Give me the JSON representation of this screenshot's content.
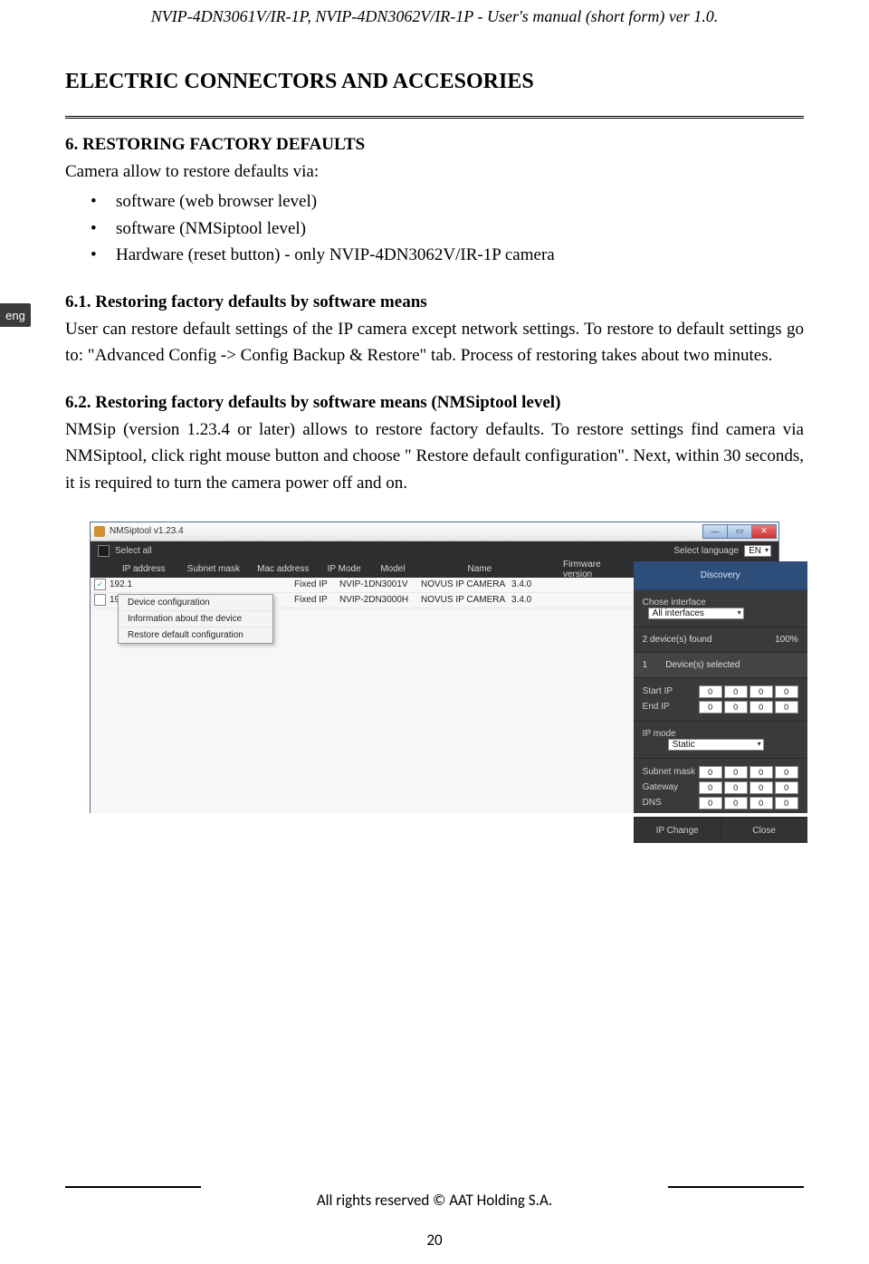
{
  "runningHead": "NVIP-4DN3061V/IR-1P, NVIP-4DN3062V/IR-1P - User's manual (short form) ver 1.0.",
  "sectionTitle": "ELECTRIC CONNECTORS AND ACCESORIES",
  "langTab": "eng",
  "h6_0": "6. RESTORING FACTORY DEFAULTS",
  "p0": "Camera allow to restore defaults via:",
  "bullets": {
    "b0": "software (web browser level)",
    "b1": "software (NMSiptool level)",
    "b2": "Hardware (reset button) - only NVIP-4DN3062V/IR-1P camera"
  },
  "h6_1": "6.1. Restoring factory defaults by software means",
  "p1": "User can restore default settings of the IP camera except network settings. To restore to default settings go to: \"Advanced Config -> Config Backup & Restore\" tab. Process of restoring takes about two minutes.",
  "h6_2": "6.2. Restoring factory defaults by software means (NMSiptool level)",
  "p2": "NMSip (version 1.23.4 or later) allows to restore factory defaults. To restore settings find camera via NMSiptool, click right mouse button and choose \" Restore default configuration\". Next, within 30 seconds, it is required to turn the camera power off and on.",
  "shot": {
    "title": "NMSiptool v1.23.4",
    "selectAll": "Select all",
    "selLangLbl": "Select language",
    "selLangVal": "EN",
    "cols": {
      "c0": "IP address",
      "c1": "Subnet mask",
      "c2": "Mac address",
      "c3": "IP Mode",
      "c4": "Model",
      "c5": "Name",
      "c6": "Firmware version"
    },
    "rows": {
      "r0": {
        "ip": "192.1",
        "mode": "Fixed IP",
        "model": "NVIP-1DN3001V",
        "name": "NOVUS IP CAMERA",
        "fw": "3.4.0"
      },
      "r1": {
        "ip": "192.1",
        "mode": "Fixed IP",
        "model": "NVIP-2DN3000H",
        "name": "NOVUS IP CAMERA",
        "fw": "3.4.0"
      }
    },
    "ctx": {
      "m0": "Device configuration",
      "m1": "Information about the device",
      "m2": "Restore default configuration"
    },
    "discovery": "Discovery",
    "choseIf": "Chose interface",
    "choseIfVal": "All interfaces",
    "found": "2 device(s) found",
    "foundPct": "100%",
    "selCount": "1",
    "selLbl": "Device(s) selected",
    "startIp": "Start IP",
    "endIp": "End IP",
    "ipMode": "IP mode",
    "ipModeVal": "Static",
    "subnet": "Subnet mask",
    "gateway": "Gateway",
    "dns": "DNS",
    "ipChange": "IP Change",
    "close": "Close",
    "oct": {
      "a": "0",
      "b": "0",
      "c": "0",
      "d": "0"
    }
  },
  "copyright": "All rights reserved © AAT Holding S.A.",
  "pageNum": "20"
}
